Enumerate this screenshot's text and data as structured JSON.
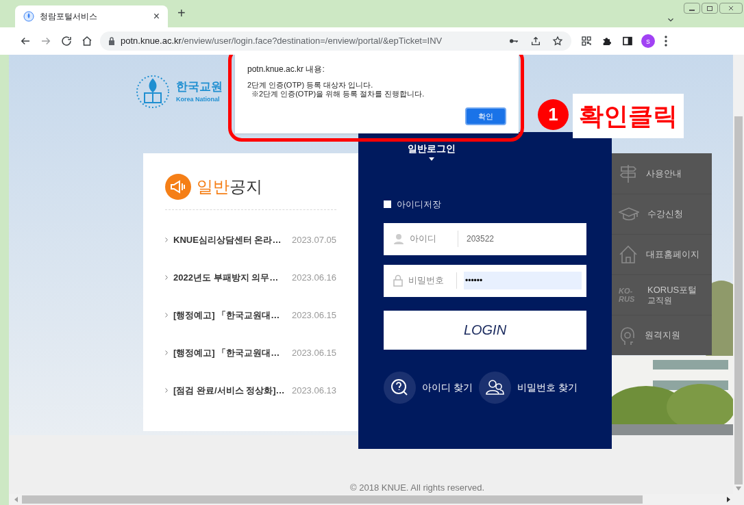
{
  "browser": {
    "tab_title": "청람포털서비스",
    "tab_close": "×",
    "new_tab": "+",
    "url_host": "potn.knue.ac.kr",
    "url_path": "/enview/user/login.face?destination=/enview/portal/&epTicket=INV",
    "profile_initial": "s"
  },
  "logo": {
    "name": "한국교원",
    "subtitle": "Korea National"
  },
  "notice": {
    "title_accent": "일반",
    "title_rest": "공지",
    "items": [
      {
        "title": "KNUE심리상담센터 온라…",
        "date": "2023.07.05"
      },
      {
        "title": "2022년도 부패방지 의무…",
        "date": "2023.06.16"
      },
      {
        "title": "[행정예고] 「한국교원대…",
        "date": "2023.06.15"
      },
      {
        "title": "[행정예고] 「한국교원대…",
        "date": "2023.06.15"
      },
      {
        "title": "[점검 완료/서비스 정상화]…",
        "date": "2023.06.13"
      }
    ]
  },
  "login": {
    "tab": "일반로그인",
    "remember": {
      "label": "아이디저장",
      "checked": false
    },
    "id_field": {
      "label": "아이디",
      "value": "203522"
    },
    "password_field": {
      "label": "비밀번호",
      "value": "••••••",
      "highlighted": true
    },
    "button": "LOGIN",
    "find_id": "아이디 찾기",
    "find_password": "비밀번호 찾기"
  },
  "side_menu": [
    {
      "kind": "signpost",
      "label": "사용안내"
    },
    {
      "kind": "cap",
      "label": "수강신청"
    },
    {
      "kind": "house",
      "label": "대표홈페이지"
    },
    {
      "kind": "korus",
      "icon_text": [
        "KO-",
        "RUS"
      ],
      "label": "KORUS포털",
      "sublabel": "교직원"
    },
    {
      "kind": "headset",
      "label": "원격지원"
    }
  ],
  "footer": "© 2018 KNUE. All rights reserved.",
  "dialog": {
    "origin": "potn.knue.ac.kr 내용:",
    "lines": [
      "2단계 인증(OTP) 등록 대상자 입니다.",
      "※2단계 인증(OTP)을 위해 등록 절차를 진행합니다."
    ],
    "button": "확인"
  },
  "annotation": {
    "number": "1",
    "text": "확인클릭"
  }
}
